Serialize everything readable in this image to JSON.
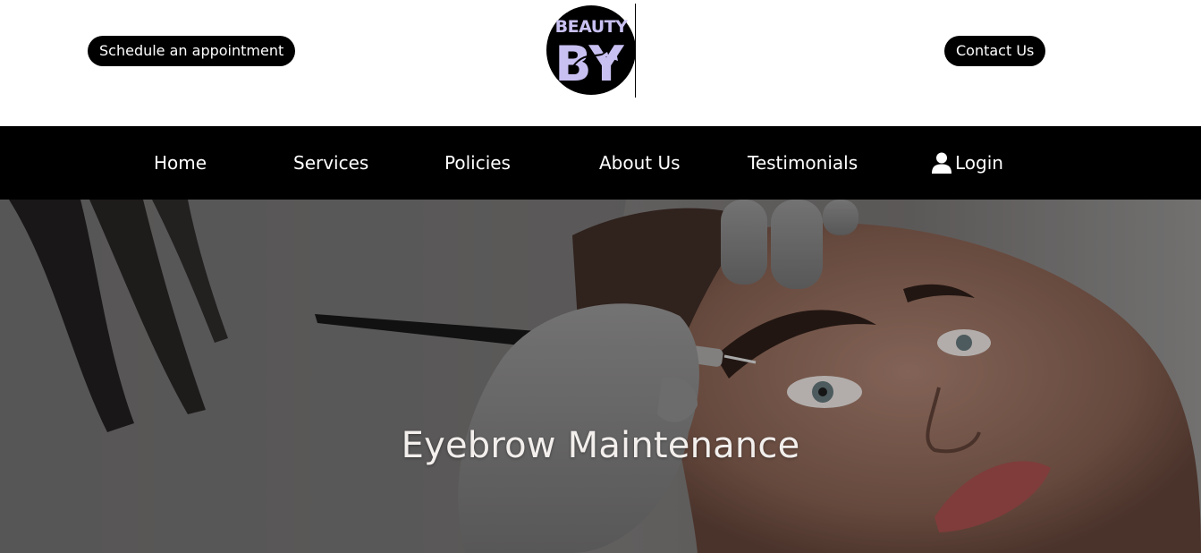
{
  "header": {
    "schedule_label": "Schedule an appointment",
    "contact_label": "Contact Us",
    "logo": {
      "text_top": "BEAUTY",
      "text_main": "BY",
      "colors": {
        "circle": "#000000",
        "letters": "#c9c0f2"
      }
    }
  },
  "nav": {
    "items": [
      {
        "label": "Home"
      },
      {
        "label": "Services"
      },
      {
        "label": "Policies"
      },
      {
        "label": "About Us"
      },
      {
        "label": "Testimonials"
      }
    ],
    "login": {
      "label": "Login",
      "icon": "user-icon"
    }
  },
  "hero": {
    "title": "Eyebrow Maintenance"
  },
  "colors": {
    "nav_bg": "#000000",
    "button_bg": "#000000",
    "text_on_dark": "#ffffff"
  }
}
